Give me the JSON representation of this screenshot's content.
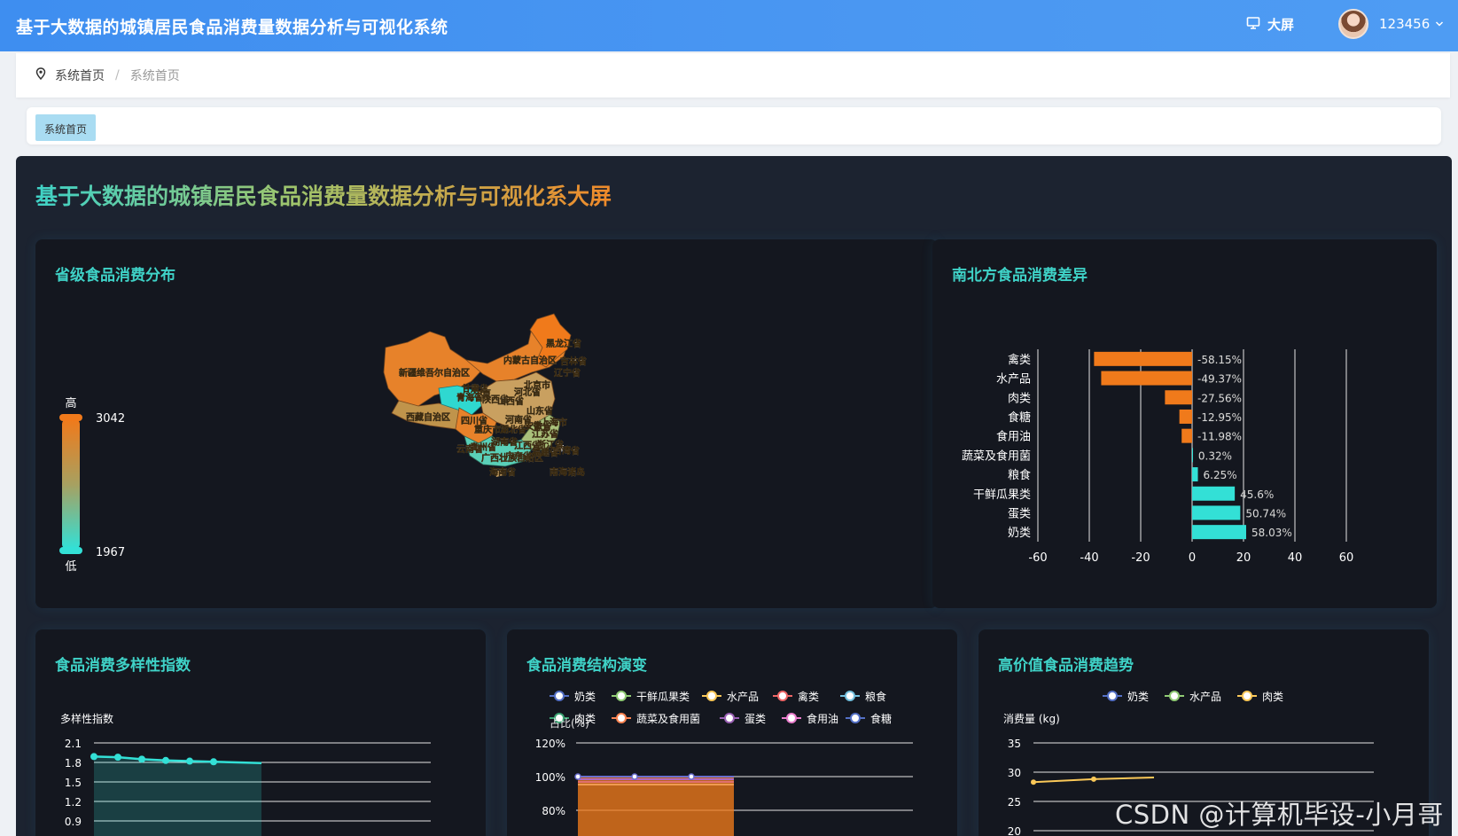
{
  "header": {
    "app_title": "基于大数据的城镇居民食品消费量数据分析与可视化系统",
    "bigscreen_label": "大屏",
    "username": "123456",
    "monitor_icon": "monitor-icon",
    "chevron_icon": "chevron-down-icon"
  },
  "breadcrumb": {
    "home": "系统首页",
    "separator": "/",
    "current": "系统首页",
    "icon": "location-pin-icon"
  },
  "tabs": [
    {
      "label": "系统首页"
    }
  ],
  "dashboard": {
    "title": "基于大数据的城镇居民食品消费量数据分析与可视化系大屏",
    "colors": {
      "orange": "#f07a1b",
      "cyan": "#33e0d6",
      "bg": "#1c2330",
      "panel": "#14171f",
      "title_cyan": "#3fd2c7"
    },
    "map_panel": {
      "title": "省级食品消费分布",
      "legend_high": "高",
      "legend_low": "低",
      "legend_max": "3042",
      "legend_min": "1967",
      "region_labels": [
        "黑龙江省",
        "吉林省",
        "辽宁省",
        "内蒙古自治区",
        "新疆维吾尔自治区",
        "甘肃省",
        "青海省",
        "宁夏",
        "陕西省",
        "山西省",
        "河北省",
        "北京市",
        "山东省",
        "河南省",
        "西藏自治区",
        "四川省",
        "重庆市",
        "湖北省",
        "安徽省",
        "上海市",
        "江苏省",
        "湖南省",
        "江西省",
        "浙江省",
        "贵州省",
        "云南省",
        "广西壮族自治区",
        "广东省",
        "福建省",
        "台湾省",
        "海南省",
        "南海诸岛"
      ]
    },
    "north_south": {
      "title": "南北方食品消费差异",
      "chart_data": {
        "type": "bar",
        "orientation": "horizontal",
        "categories": [
          "禽类",
          "水产品",
          "肉类",
          "食糖",
          "食用油",
          "蔬菜及食用菌",
          "粮食",
          "干鲜瓜果类",
          "蛋类",
          "奶类"
        ],
        "values": [
          -38.15,
          -35.37,
          -10.56,
          -4.95,
          -4.06,
          0.32,
          2.25,
          16.6,
          18.74,
          21.03
        ],
        "value_labels": [
          "-58.15%",
          "-49.37%",
          "-27.56%",
          "-12.95%",
          "-11.98%",
          "0.32%",
          "6.25%",
          "45.6%",
          "50.74%",
          "58.03%"
        ],
        "xlim": [
          -60,
          60
        ],
        "xticks": [
          "-60",
          "-40",
          "-20",
          "0",
          "20",
          "40",
          "60"
        ],
        "colors": {
          "negative": "#f07a1b",
          "positive": "#33e0d6"
        }
      }
    },
    "diversity": {
      "title": "食品消费多样性指数",
      "chart_data": {
        "type": "area",
        "ylabel": "多样性指数",
        "yticks": [
          "2.1",
          "1.8",
          "1.5",
          "1.2",
          "0.9"
        ],
        "ylim": [
          0.9,
          2.1
        ],
        "values": [
          1.89,
          1.88,
          1.85,
          1.83,
          1.82,
          1.81,
          1.8,
          1.79
        ],
        "color": "#33e0d6"
      }
    },
    "structure": {
      "title": "食品消费结构演变",
      "legend": [
        "奶类",
        "干鲜瓜果类",
        "水产品",
        "禽类",
        "粮食",
        "肉类",
        "蔬菜及食用菌",
        "蛋类",
        "食用油",
        "食糖"
      ],
      "legend_colors": [
        "#5470c6",
        "#91cc75",
        "#fac858",
        "#ee6666",
        "#73c0de",
        "#3ba272",
        "#fc8452",
        "#9a60b4",
        "#ea7ccc",
        "#5470c6"
      ],
      "chart_data": {
        "type": "area",
        "ylabel": "占比(%)",
        "yticks": [
          "120%",
          "100%",
          "80%"
        ],
        "ylim": [
          80,
          120
        ],
        "stacked_total": [
          100,
          100,
          100
        ],
        "color": "#f07a1b"
      }
    },
    "premium": {
      "title": "高价值食品消费趋势",
      "legend": [
        "奶类",
        "水产品",
        "肉类"
      ],
      "legend_colors": [
        "#5470c6",
        "#91cc75",
        "#fac858"
      ],
      "chart_data": {
        "type": "line",
        "ylabel": "消费量 (kg)",
        "yticks": [
          "35",
          "30",
          "25",
          "20"
        ],
        "ylim": [
          20,
          35
        ],
        "series": [
          {
            "name": "肉类",
            "values": [
              28.3,
              28.8,
              29.1
            ]
          }
        ]
      }
    }
  },
  "watermark": "CSDN @计算机毕设-小月哥"
}
